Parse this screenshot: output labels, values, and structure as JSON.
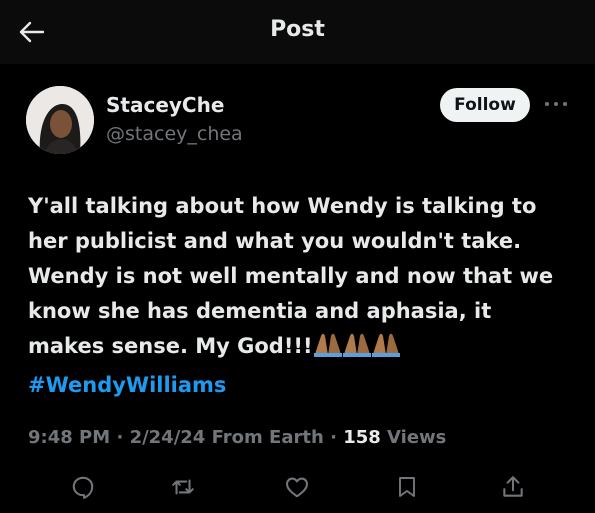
{
  "header": {
    "title": "Post",
    "back_icon": "arrow-left-icon"
  },
  "author": {
    "display_name": "StaceyChe",
    "handle": "@stacey_chea",
    "follow_label": "Follow",
    "more_icon": "more-horizontal-icon"
  },
  "post": {
    "text": "Y'all talking about how Wendy is talking to\nher publicist and what you wouldn't take.\nWendy is not well mentally  and now that we\nknow she has dementia and aphasia, it\nmakes sense. My God!!!",
    "emojis": [
      "folded-hands-icon",
      "folded-hands-icon",
      "folded-hands-icon"
    ],
    "hashtag": "#WendyWilliams",
    "hashtag_color": "#1d9bf0"
  },
  "meta": {
    "time": "9:48 PM",
    "date": "2/24/24",
    "location": "From Earth",
    "views_count": "158",
    "views_label": "Views"
  },
  "actions": [
    {
      "icon": "reply-icon"
    },
    {
      "icon": "repost-icon"
    },
    {
      "icon": "like-icon"
    },
    {
      "icon": "bookmark-icon"
    },
    {
      "icon": "share-icon"
    }
  ],
  "colors": {
    "background": "#000000",
    "text": "#e7e9ea",
    "secondary": "#71767b",
    "accent": "#1d9bf0"
  }
}
